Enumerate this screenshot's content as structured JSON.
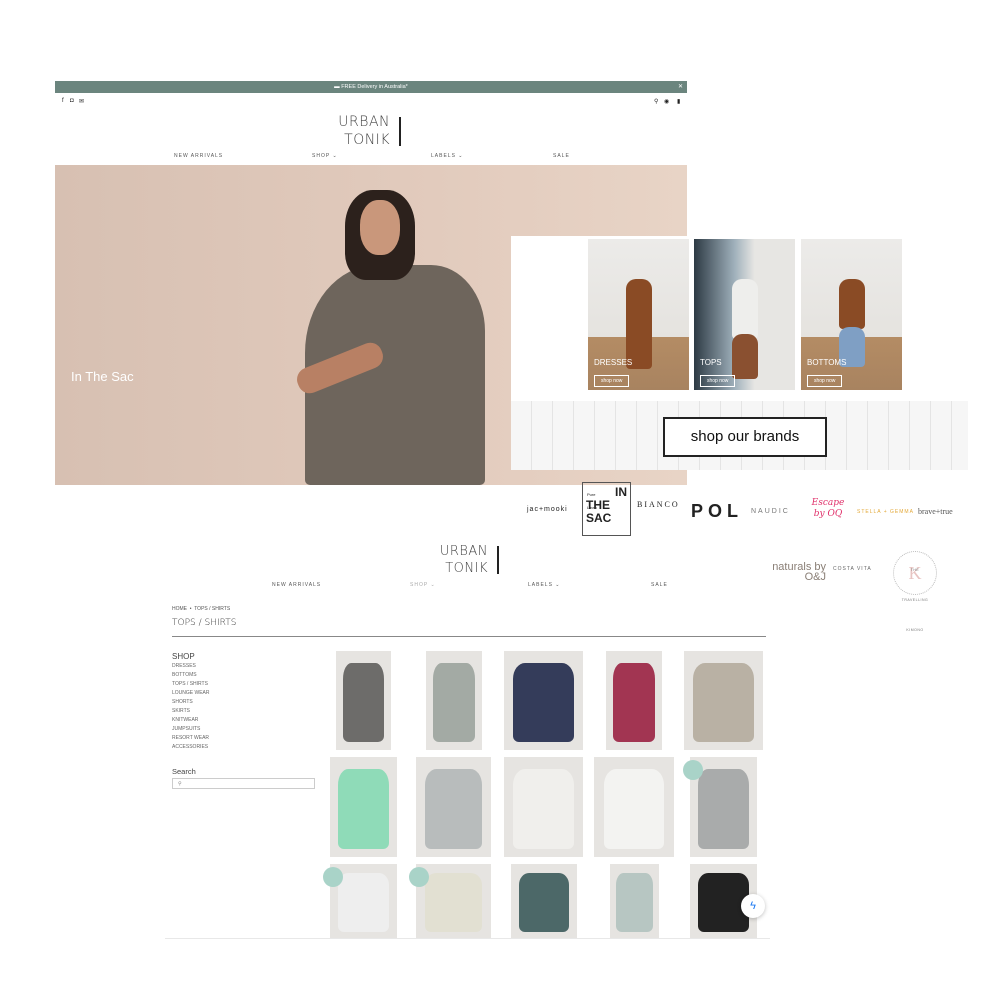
{
  "top_site": {
    "announcement": "FREE Delivery in Australia*",
    "close_icon": "close-icon",
    "social_icons": [
      "facebook-icon",
      "instagram-icon",
      "email-icon"
    ],
    "utility_icons": [
      "search-icon",
      "account-icon",
      "bag-icon"
    ],
    "logo": {
      "line1": "URBAN",
      "line2": "TONIK"
    },
    "nav": [
      "NEW ARRIVALS",
      "SHOP",
      "LABELS",
      "SALE"
    ],
    "hero_title": "In The Sac"
  },
  "categories": [
    {
      "label": "DRESSES",
      "button": "shop now"
    },
    {
      "label": "TOPS",
      "button": "shop now"
    },
    {
      "label": "BOTTOMS",
      "button": "shop now"
    }
  ],
  "brands_button": "shop our brands",
  "brands": [
    "jac+mooki",
    "Pure Linen IN THE SAC",
    "BIANCO",
    "POL",
    "NAUDIC",
    "Escape by OQ",
    "STELLA + GEMMA",
    "brave+true",
    "naturals by O&J",
    "COSTA VITA",
    "THE TRAVELLING KIMONO"
  ],
  "category_page": {
    "logo": {
      "line1": "URBAN",
      "line2": "TONIK"
    },
    "nav": [
      "NEW ARRIVALS",
      "SHOP",
      "LABELS",
      "SALE"
    ],
    "breadcrumb": [
      "HOME",
      "TOPS / SHIRTS"
    ],
    "title": "TOPS / SHIRTS",
    "sidebar": {
      "heading": "SHOP",
      "items": [
        "DRESSES",
        "BOTTOMS",
        "TOPS / SHIRTS",
        "LOUNGE WEAR",
        "SHORTS",
        "SKIRTS",
        "KNITWEAR",
        "JUMPSUITS",
        "RESORT WEAR",
        "ACCESSORIES"
      ],
      "search_label": "Search",
      "search_placeholder": ""
    },
    "products": [
      {
        "color": "#6d6c6a",
        "badge": false
      },
      {
        "color": "#a3aaa4",
        "badge": false
      },
      {
        "color": "#343c5a",
        "badge": false
      },
      {
        "color": "#a23552",
        "badge": false
      },
      {
        "color": "#b9b1a4",
        "badge": false
      },
      {
        "color": "#8fdbb8",
        "badge": false
      },
      {
        "color": "#b8bcbc",
        "badge": false
      },
      {
        "color": "#f0efec",
        "badge": false
      },
      {
        "color": "#f3f3f1",
        "badge": false
      },
      {
        "color": "#a9abab",
        "badge": true
      },
      {
        "color": "#eeeeee",
        "badge": true
      },
      {
        "color": "#e2e0d2",
        "badge": true
      },
      {
        "color": "#4c6868",
        "badge": false
      },
      {
        "color": "#b7c6c2",
        "badge": false
      },
      {
        "color": "#222222",
        "badge": false
      }
    ],
    "chat_icon": "messenger-icon"
  }
}
